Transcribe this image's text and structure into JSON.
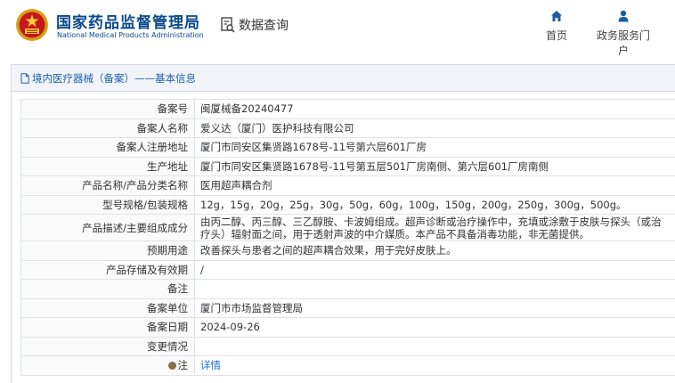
{
  "header": {
    "brand_cn": "国家药品监督管理局",
    "brand_en": "National Medical Products Administration",
    "query_label": "数据查询",
    "nav": [
      {
        "label": "首页",
        "icon": "home-icon"
      },
      {
        "label": "政务服务门户",
        "icon": "user-icon"
      }
    ]
  },
  "panel": {
    "title": "境内医疗器械（备案）——基本信息",
    "rows": [
      {
        "label": "备案号",
        "value": "闽厦械备20240477"
      },
      {
        "label": "备案人名称",
        "value": "爱义达（厦门）医护科技有限公司"
      },
      {
        "label": "备案人注册地址",
        "value": "厦门市同安区集贤路1678号-11号第六层601厂房"
      },
      {
        "label": "生产地址",
        "value": "厦门市同安区集贤路1678号-11号第五层501厂房南侧、第六层601厂房南侧"
      },
      {
        "label": "产品名称/产品分类名称",
        "value": "医用超声耦合剂"
      },
      {
        "label": "型号规格/包装规格",
        "value": "12g，15g，20g，25g，30g，50g，60g，100g，150g，200g，250g，300g，500g。"
      },
      {
        "label": "产品描述/主要组成成分",
        "value": "由丙二醇、丙三醇、三乙醇胺、卡波姆组成。超声诊断或治疗操作中，充填或涂敷于皮肤与探头（或治疗头）辐射面之间，用于透射声波的中介媒质。本产品不具备消毒功能，非无菌提供。"
      },
      {
        "label": "预期用途",
        "value": "改善探头与患者之间的超声耦合效果，用于完好皮肤上。"
      },
      {
        "label": "产品存储及有效期",
        "value": "/"
      },
      {
        "label": "备注",
        "value": ""
      },
      {
        "label": "备案单位",
        "value": "厦门市市场监督管理局"
      },
      {
        "label": "备案日期",
        "value": "2024-09-26"
      },
      {
        "label": "变更情况",
        "value": ""
      },
      {
        "label": "注",
        "value": "详情"
      }
    ]
  },
  "colors": {
    "brand": "#0b4a8b",
    "link": "#1f6fcf",
    "panel_header_bg": "#f1f5f9"
  }
}
